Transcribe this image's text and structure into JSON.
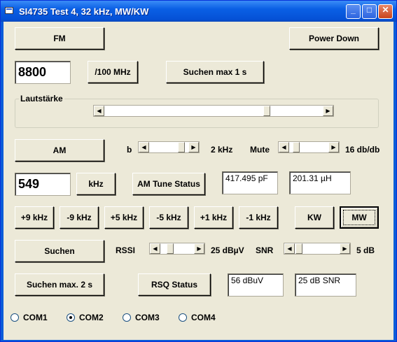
{
  "window": {
    "title": "SI4735 Test 4, 32 kHz, MW/KW",
    "minimize": "_",
    "maximize": "□",
    "close": "✕"
  },
  "buttons": {
    "fm": "FM",
    "power_down": "Power Down",
    "div100": "/100 MHz",
    "search1": "Suchen max 1 s",
    "am": "AM",
    "khz": "kHz",
    "am_tune_status": "AM Tune Status",
    "p9": "+9 kHz",
    "m9": "-9 kHz",
    "p5": "+5 kHz",
    "m5": "-5 kHz",
    "p1": "+1 kHz",
    "m1": "-1 kHz",
    "kw": "KW",
    "mw": "MW",
    "suchen": "Suchen",
    "suchen2": "Suchen  max. 2 s",
    "rsq_status": "RSQ Status"
  },
  "fields": {
    "freq_fm": "8800",
    "freq_am": "549",
    "capacitance": "417.495 pF",
    "inductance": "201.31 µH",
    "rssi_value": "56 dBuV",
    "snr_value": "25 dB SNR"
  },
  "labels": {
    "lautstaerke": "Lautstärke",
    "b": "b",
    "bw": "2 kHz",
    "mute": "Mute",
    "mute_val": "16 db/db",
    "rssi": "RSSI",
    "rssi_val": "25 dBµV",
    "snr": "SNR",
    "snr_val": "5 dB"
  },
  "radios": [
    "COM1",
    "COM2",
    "COM3",
    "COM4"
  ],
  "selected_radio": "COM2"
}
